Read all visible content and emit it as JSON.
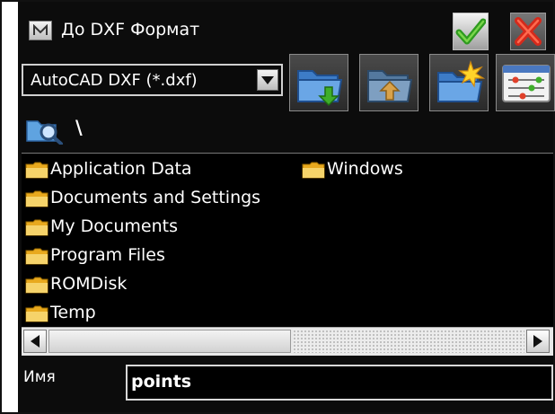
{
  "window": {
    "title": "До DXF Формат",
    "app_icon": "app-icon-m",
    "ok_icon": "green-checkmark-icon",
    "cancel_icon": "red-x-icon"
  },
  "format": {
    "selected": "AutoCAD DXF (*.dxf)",
    "arrow_icon": "chevron-down-icon"
  },
  "toolbar": [
    {
      "name": "folder-open-icon"
    },
    {
      "name": "folder-up-icon"
    },
    {
      "name": "new-folder-icon"
    },
    {
      "name": "view-options-icon"
    }
  ],
  "path": {
    "icon": "search-folder-icon",
    "current": "\\"
  },
  "files": {
    "col1": [
      "Application Data",
      "Documents and Settings",
      "My Documents",
      "Program Files",
      "ROMDisk",
      "Temp"
    ],
    "col2": [
      "Windows"
    ]
  },
  "name": {
    "label": "Имя",
    "value": "points"
  },
  "colors": {
    "background": "#0c0c0c",
    "text": "#ffffff",
    "folder": "#f2c84b",
    "ok_accent": "#2e9a1f",
    "cancel_accent": "#d42a1c"
  }
}
